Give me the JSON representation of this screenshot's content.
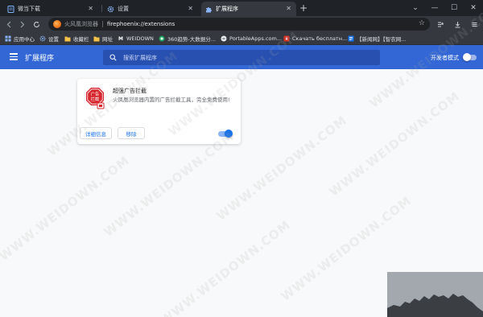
{
  "tabs": [
    {
      "title": "微当下载",
      "icon": "document-icon",
      "active": false
    },
    {
      "title": "设置",
      "icon": "gear-icon",
      "active": false
    },
    {
      "title": "扩展程序",
      "icon": "puzzle-icon",
      "active": true
    }
  ],
  "window_controls": {
    "tab_search": "⌄",
    "minimize": "—",
    "maximize": "☐",
    "close": "✕"
  },
  "toolbar": {
    "site_label": "火风凰浏览器",
    "url": "firephoenix://extensions"
  },
  "bookmarks": [
    {
      "label": "应用中心",
      "icon": "apps-grid-icon"
    },
    {
      "label": "设置",
      "icon": "gear-icon"
    },
    {
      "label": "收藏栏",
      "icon": "folder-icon"
    },
    {
      "label": "网址",
      "icon": "folder-icon"
    },
    {
      "label": "WEIDOWN",
      "icon": "weidown-logo-icon"
    },
    {
      "label": "360趋势-大数据分...",
      "icon": "trend-icon"
    },
    {
      "label": "PortableApps.com...",
      "icon": "portableapps-icon"
    },
    {
      "label": "Скачать бесплатн...",
      "icon": "download-icon"
    },
    {
      "label": "【新闻网】【智农网...",
      "icon": "news-icon"
    }
  ],
  "header": {
    "title": "扩展程序",
    "search_placeholder": "搜索扩展程序",
    "dev_mode_label": "开发者模式",
    "dev_mode_enabled": false
  },
  "extension": {
    "name": "超强广告拦截",
    "description": "火凤凰浏览器内置的广告拦截工具，完全免费使用!",
    "icon_text_line1": "广告",
    "icon_text_line2": "拦截",
    "details_button": "详细信息",
    "remove_button": "移除",
    "enabled": true
  },
  "watermark_text": "WWW.WEIDOWN.COM",
  "colors": {
    "header_bg": "#3367d6",
    "accent": "#1a73e8",
    "tab_strip_bg": "#1f2328",
    "toolbar_bg": "#35393f",
    "extension_icon_red": "#d7282f"
  }
}
